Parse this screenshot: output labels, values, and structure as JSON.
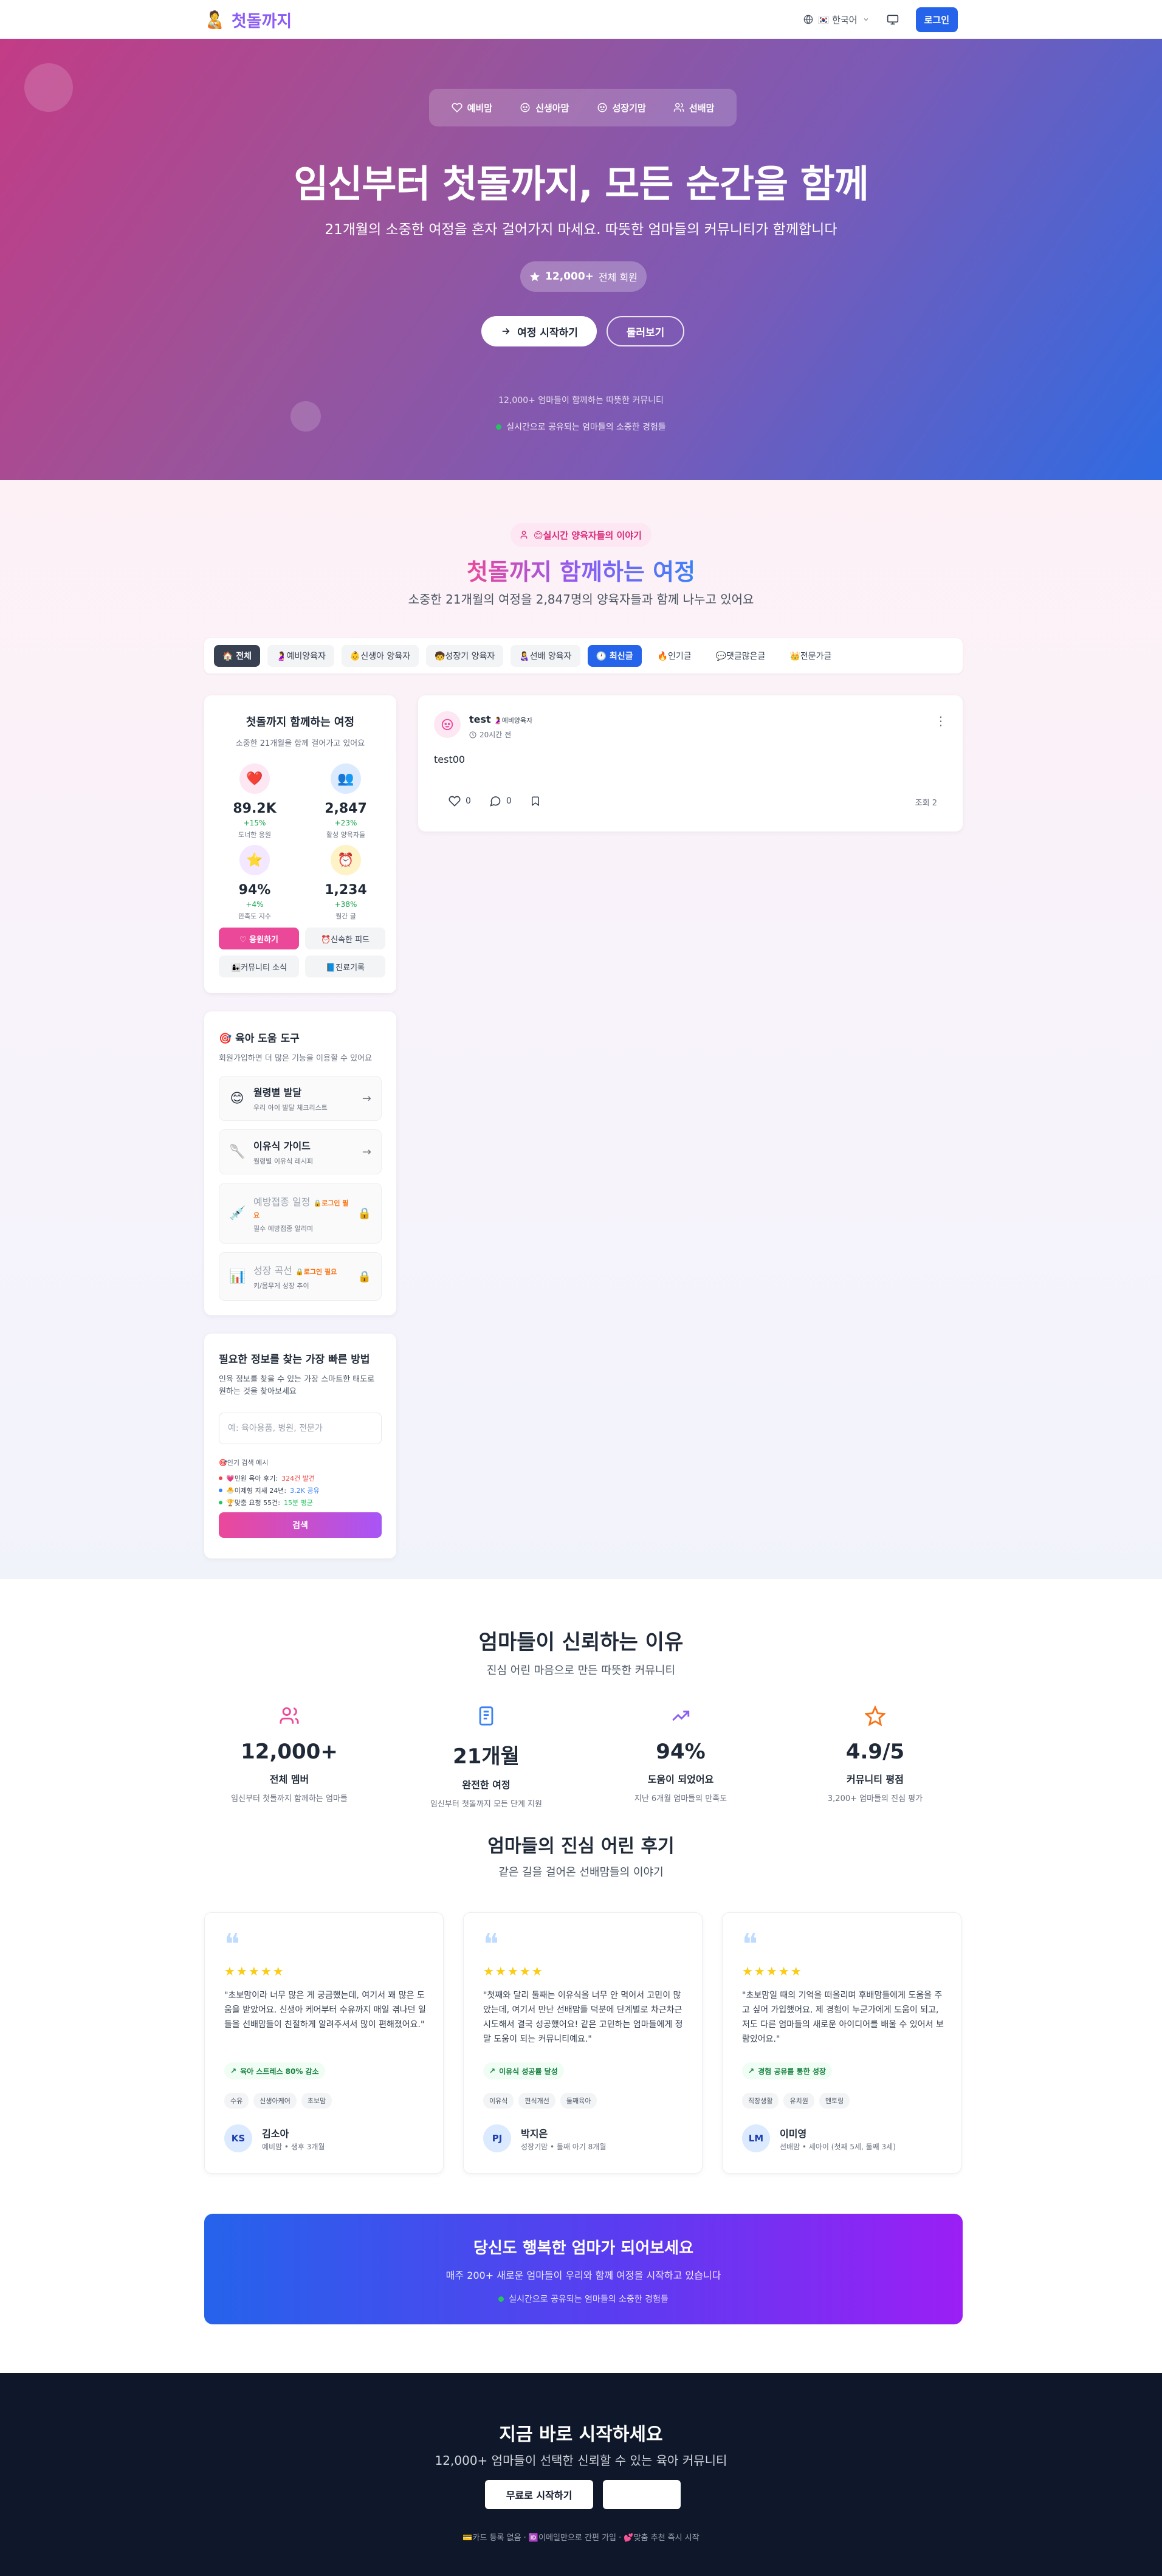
{
  "nav": {
    "brand": "첫돌까지",
    "brand_icon": "🧑‍🍼",
    "language": "🇰🇷 한국어",
    "login": "로그인"
  },
  "hero": {
    "tabs": [
      {
        "label": "예비맘",
        "icon": "heart-icon"
      },
      {
        "label": "신생아맘",
        "icon": "baby-icon"
      },
      {
        "label": "성장기맘",
        "icon": "baby-icon"
      },
      {
        "label": "선배맘",
        "icon": "users-icon"
      }
    ],
    "title": "임신부터 첫돌까지, 모든 순간을 함께",
    "subtitle": "21개월의 소중한 여정을 혼자 걸어가지 마세요. 따뜻한 엄마들의 커뮤니티가 함께합니다",
    "members_count": "12,000+",
    "members_label": "전체 회원",
    "start_button": "여정 시작하기",
    "look_button": "둘러보기",
    "note": "12,000+ 엄마들이 함께하는 따뜻한 커뮤니티",
    "live": "실시간으로 공유되는 엄마들의 소중한 경험들"
  },
  "community": {
    "badge": "😊실시간 양육자들의 이야기",
    "title": "첫돌까지 함께하는 여정",
    "subtitle": "소중한 21개월의 여정을 2,847명의 양육자들과 함께 나누고 있어요",
    "filters": [
      {
        "label": "🏠 전체",
        "style": "dark"
      },
      {
        "label": "🤰예비양육자",
        "style": "light"
      },
      {
        "label": "👶신생아 양육자",
        "style": "light"
      },
      {
        "label": "🧒성장기 양육자",
        "style": "light"
      },
      {
        "label": "👩‍🍼선배 양육자",
        "style": "light"
      },
      {
        "label": "🕐 최신글",
        "style": "blue"
      },
      {
        "label": "🔥인기글",
        "style": "plain"
      },
      {
        "label": "💬댓글많은글",
        "style": "plain"
      },
      {
        "label": "👑전문가글",
        "style": "plain"
      }
    ],
    "stats_card": {
      "title": "첫돌까지 함께하는 여정",
      "subtitle": "소중한 21개월을 함께 걸어가고 있어요",
      "stats": [
        {
          "icon": "❤️",
          "value": "89.2K",
          "change": "+15%",
          "label": "도너한 응원",
          "bg": "#fce7f3"
        },
        {
          "icon": "👥",
          "value": "2,847",
          "change": "+23%",
          "label": "활성 양육자들",
          "bg": "#dbeafe"
        },
        {
          "icon": "⭐",
          "value": "94%",
          "change": "+4%",
          "label": "만족도 지수",
          "bg": "#f3e8ff"
        },
        {
          "icon": "⏰",
          "value": "1,234",
          "change": "+38%",
          "label": "월간 글",
          "bg": "#fef3c7"
        }
      ],
      "buttons": [
        "♡ 응원하기",
        "⏰신속한 피드",
        "👩‍👧커뮤니티 소식",
        "📘진료기록"
      ]
    },
    "tools_card": {
      "title": "🎯 육아 도움 도구",
      "subtitle": "회원가입하면 더 많은 기능을 이용할 수 있어요",
      "tools": [
        {
          "icon": "😊",
          "name": "월령별 발달",
          "desc": "우리 아이 발달 체크리스트",
          "locked": false
        },
        {
          "icon": "🥄",
          "name": "이유식 가이드",
          "desc": "월령별 이유식 레시피",
          "locked": false
        },
        {
          "icon": "💉",
          "name": "예방접종 일정",
          "desc": "필수 예방접종 알리미",
          "locked": true,
          "badge": "🔒로그인 필요"
        },
        {
          "icon": "📊",
          "name": "성장 곡선",
          "desc": "키/몸무게 성장 추이",
          "locked": true,
          "badge": "🔒로그인 필요"
        }
      ]
    },
    "search_card": {
      "title": "필요한 정보를 찾는 가장 빠른 방법",
      "subtitle": "인육 정보를 찾을 수 있는 가장 스마트한 태도로 원하는 것을 찾아보세요",
      "placeholder": "예: 육아용품, 병원, 전문가",
      "popular_heading": "🎯인기 검색 예시",
      "popular": [
        {
          "text": "💗민원 육아 후기:",
          "count": "324건 발견",
          "color": "#ef4444"
        },
        {
          "text": "🐣이제형 지새 24년:",
          "count": "3.2K 공유",
          "color": "#3b82f6"
        },
        {
          "text": "🏆맞춤 요청 55건:",
          "count": "15분 평균",
          "color": "#22c55e"
        }
      ],
      "button": "검색"
    },
    "post": {
      "author": "test",
      "tag": "🤰예비양육자",
      "time": "20시간 전",
      "body": "test00",
      "likes": "0",
      "comments": "0",
      "views": "조회 2"
    }
  },
  "trust": {
    "title": "엄마들이 신뢰하는 이유",
    "subtitle": "진심 어린 마음으로 만든 따뜻한 커뮤니티",
    "stats": [
      {
        "icon": "users-icon",
        "value": "12,000+",
        "label": "전체 멤버",
        "desc": "임신부터 첫돌까지 함께하는 엄마들",
        "color": "#ec4899"
      },
      {
        "icon": "book-icon",
        "value": "21개월",
        "label": "완전한 여정",
        "desc": "임신부터 첫돌까지 모든 단계 지원",
        "color": "#3b82f6"
      },
      {
        "icon": "trend-icon",
        "value": "94%",
        "label": "도움이 되었어요",
        "desc": "지난 6개월 엄마들의 만족도",
        "color": "#8b5cf6"
      },
      {
        "icon": "star-icon",
        "value": "4.9/5",
        "label": "커뮤니티 평점",
        "desc": "3,200+ 엄마들의 진심 평가",
        "color": "#f97316"
      }
    ]
  },
  "reviews": {
    "title": "엄마들의 진심 어린 후기",
    "subtitle": "같은 길을 걸어온 선배맘들의 이야기",
    "stars": "★★★★★",
    "items": [
      {
        "text": "\"초보맘이라 너무 많은 게 궁금했는데, 여기서 꽤 많은 도움을 받았어요. 신생아 케어부터 수유까지 매일 겪나던 일들을 선배맘들이 친절하게 알려주셔서 많이 편해졌어요.\"",
        "badge": "육아 스트레스 80% 감소",
        "tags": [
          "수유",
          "신생아케어",
          "초보맘"
        ],
        "initials": "KS",
        "name": "김소아",
        "meta": "예비맘 • 생후 3개월"
      },
      {
        "text": "\"첫째와 달리 둘째는 이유식을 너무 안 먹어서 고민이 많았는데, 여기서 만난 선배맘들 덕분에 단계별로 차근차근 시도해서 결국 성공했어요! 같은 고민하는 엄마들에게 정말 도움이 되는 커뮤니티예요.\"",
        "badge": "이유식 성공률 달성",
        "tags": [
          "이유식",
          "편식개선",
          "둘째육아"
        ],
        "initials": "PJ",
        "name": "박지은",
        "meta": "성장기맘 • 둘째 아기 8개월"
      },
      {
        "text": "\"초보맘일 때의 기억을 떠올리며 후배맘들에게 도움을 주고 싶어 가입했어요. 제 경험이 누군가에게 도움이 되고, 저도 다른 엄마들의 새로운 아이디어를 배울 수 있어서 보람있어요.\"",
        "badge": "경험 공유를 통한 성장",
        "tags": [
          "직장생활",
          "유치원",
          "멘토링"
        ],
        "initials": "LM",
        "name": "이미영",
        "meta": "선배맘 • 세아이 (첫째 5세, 둘째 3세)"
      }
    ]
  },
  "cta": {
    "title": "당신도 행복한 엄마가 되어보세요",
    "subtitle": "매주 200+ 새로운 엄마들이 우리와 함께 여정을 시작하고 있습니다",
    "live": "실시간으로 공유되는 엄마들의 소중한 경험들"
  },
  "footer": {
    "title": "지금 바로 시작하세요",
    "subtitle": "12,000+ 엄마들이 선택한 신뢰할 수 있는 육아 커뮤니티",
    "start": "무료로 시작하기",
    "note": "💳카드 등록 없음 · 🆔이메일만으로 간편 가입 · 💕맞춤 추천 즉시 시작"
  }
}
